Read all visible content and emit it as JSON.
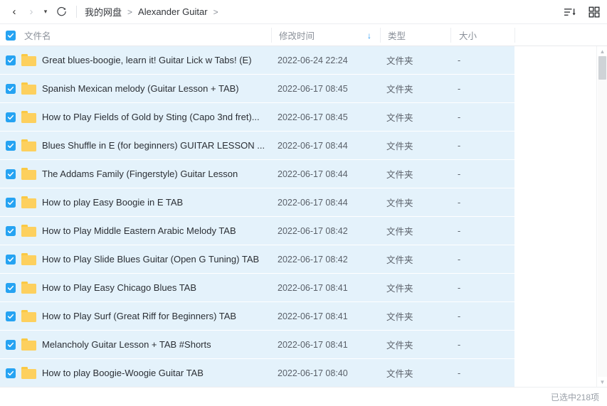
{
  "toolbar": {
    "back_icon": "chevron-left-icon",
    "forward_icon": "chevron-right-icon",
    "history_caret_icon": "caret-down-icon",
    "refresh_icon": "refresh-icon",
    "back_glyph": "‹",
    "forward_glyph": "›",
    "caret_glyph": "▾",
    "sort_icon_name": "sort-descending-icon",
    "grid_icon_name": "grid-view-icon",
    "breadcrumb": [
      {
        "label": "我的网盘"
      },
      {
        "label": "Alexander Guitar"
      }
    ],
    "breadcrumb_separator": ">"
  },
  "header": {
    "select_all_checked": true,
    "columns": [
      {
        "key": "name",
        "label": "文件名"
      },
      {
        "key": "mtime",
        "label": "修改时间",
        "sorted": true,
        "sort_glyph": "↓"
      },
      {
        "key": "type",
        "label": "类型"
      },
      {
        "key": "size",
        "label": "大小"
      }
    ]
  },
  "rows": [
    {
      "name": "Great blues-boogie, learn it!  Guitar Lick w Tabs! (E)",
      "mtime": "2022-06-24 22:24",
      "type": "文件夹",
      "size": "-",
      "checked": true
    },
    {
      "name": "Spanish  Mexican melody (Guitar Lesson + TAB)",
      "mtime": "2022-06-17 08:45",
      "type": "文件夹",
      "size": "-",
      "checked": true
    },
    {
      "name": "How to Play Fields of Gold by Sting (Capo 3nd fret)...",
      "mtime": "2022-06-17 08:45",
      "type": "文件夹",
      "size": "-",
      "checked": true
    },
    {
      "name": "Blues Shuffle in E (for beginners) GUITAR LESSON  ...",
      "mtime": "2022-06-17 08:44",
      "type": "文件夹",
      "size": "-",
      "checked": true
    },
    {
      "name": "The Addams Family (Fingerstyle) Guitar Lesson",
      "mtime": "2022-06-17 08:44",
      "type": "文件夹",
      "size": "-",
      "checked": true
    },
    {
      "name": "How to play Easy Boogie in E  TAB",
      "mtime": "2022-06-17 08:44",
      "type": "文件夹",
      "size": "-",
      "checked": true
    },
    {
      "name": "How to Play Middle Eastern Arabic Melody  TAB",
      "mtime": "2022-06-17 08:42",
      "type": "文件夹",
      "size": "-",
      "checked": true
    },
    {
      "name": "How to Play Slide Blues Guitar (Open G Tuning)  TAB",
      "mtime": "2022-06-17 08:42",
      "type": "文件夹",
      "size": "-",
      "checked": true
    },
    {
      "name": "How to Play Easy Chicago Blues  TAB",
      "mtime": "2022-06-17 08:41",
      "type": "文件夹",
      "size": "-",
      "checked": true
    },
    {
      "name": "How to Play Surf (Great Riff for Beginners)  TAB",
      "mtime": "2022-06-17 08:41",
      "type": "文件夹",
      "size": "-",
      "checked": true
    },
    {
      "name": "Melancholy  Guitar Lesson + TAB #Shorts",
      "mtime": "2022-06-17 08:41",
      "type": "文件夹",
      "size": "-",
      "checked": true
    },
    {
      "name": "How to play Boogie-Woogie Guitar  TAB",
      "mtime": "2022-06-17 08:40",
      "type": "文件夹",
      "size": "-",
      "checked": true
    }
  ],
  "scrollbar": {
    "up_glyph": "▲",
    "down_glyph": "▼"
  },
  "status": {
    "selected_text": "已选中218项"
  },
  "colors": {
    "accent": "#26a3f2",
    "row_selected_bg": "#e4f2fb",
    "folder": "#fdd05e",
    "text_primary": "#2b2f35",
    "text_secondary": "#5a6069",
    "text_muted": "#9aa0a8"
  }
}
